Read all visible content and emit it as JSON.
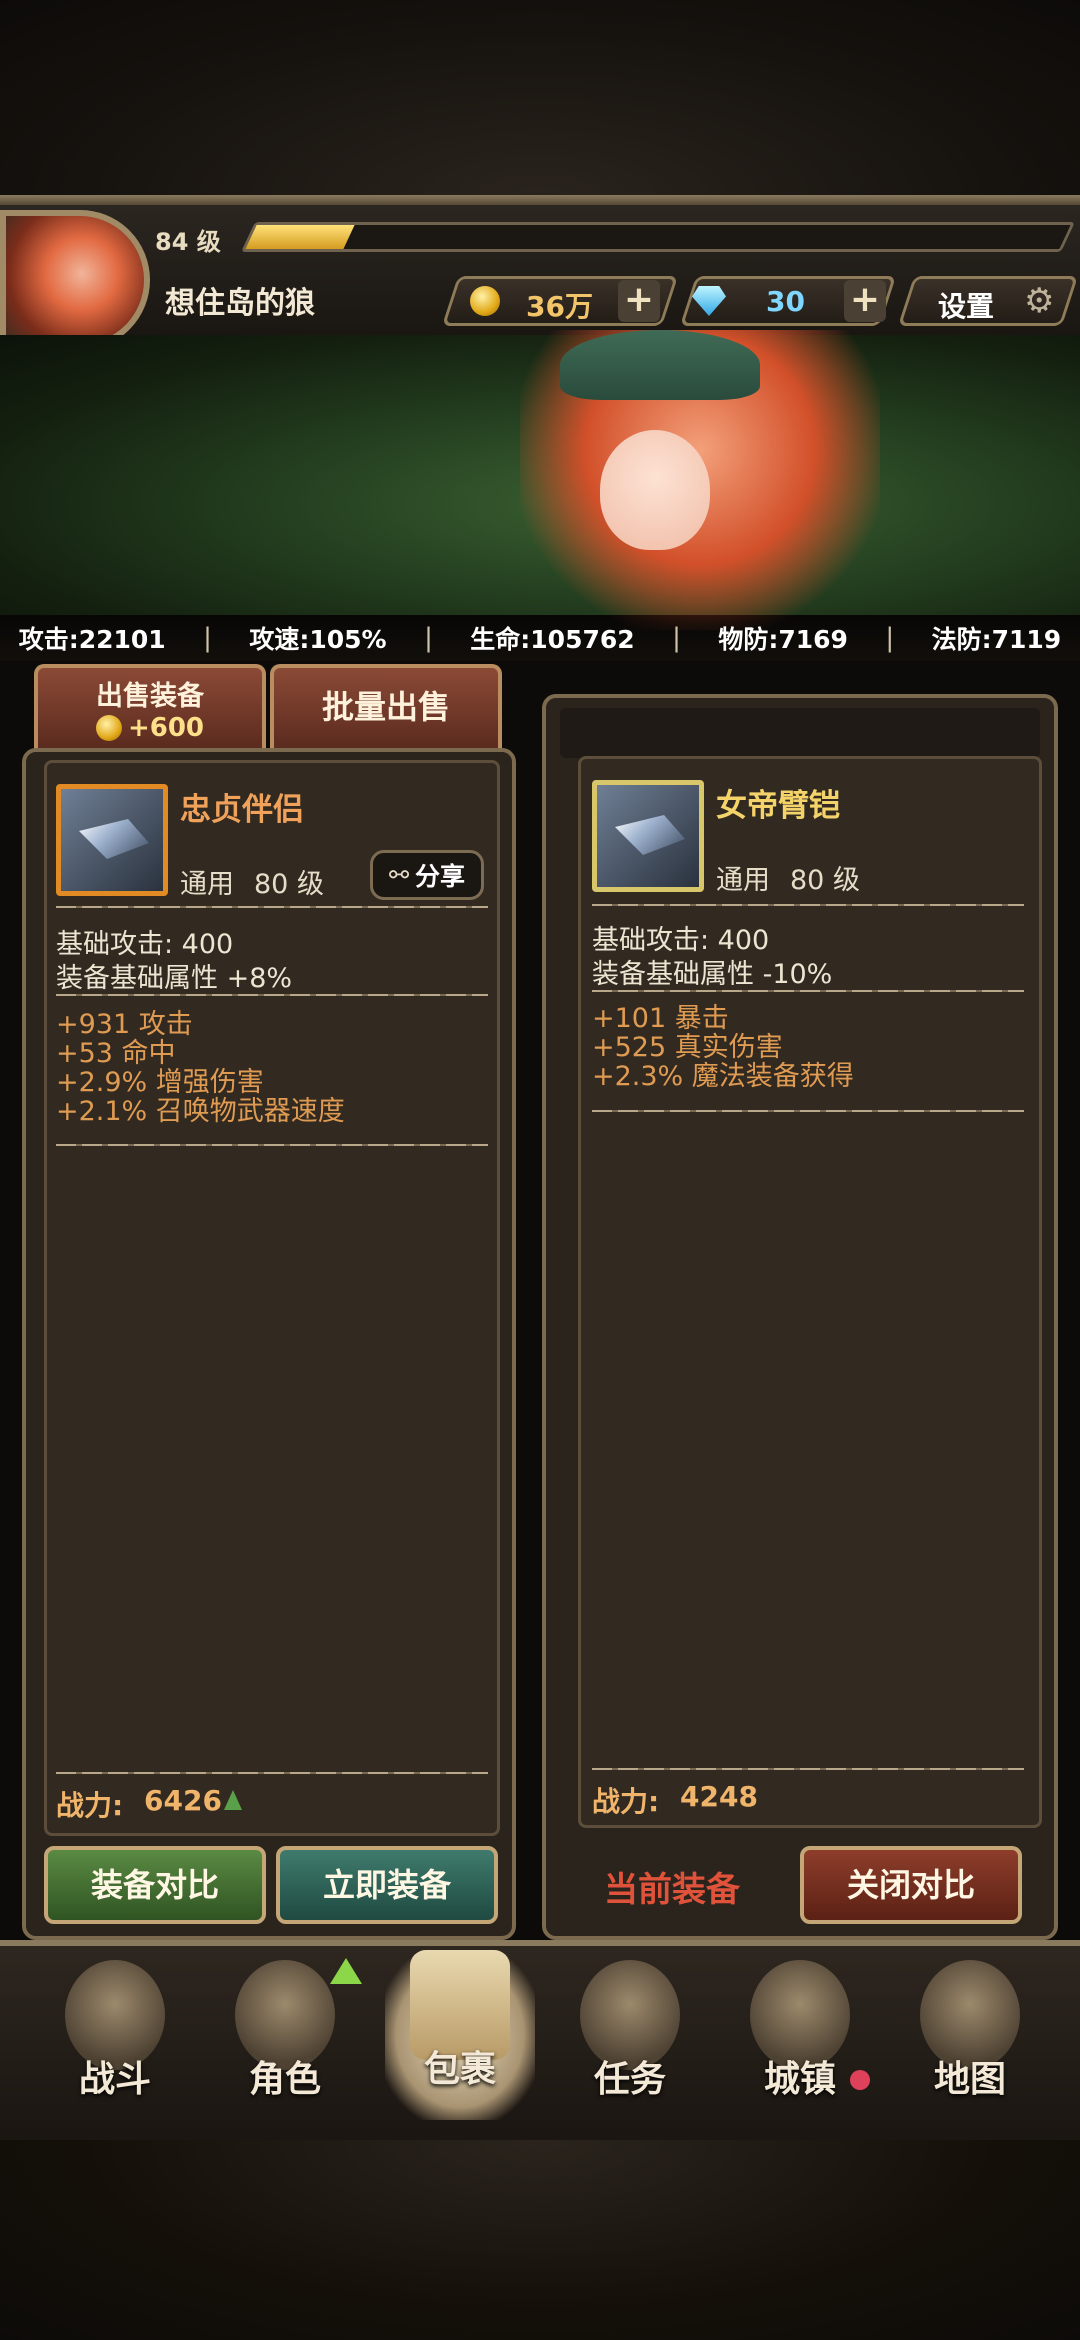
{
  "player": {
    "level": "84 级",
    "xp_fraction": 0.12,
    "name": "想住岛的狼",
    "gold": "36万",
    "gems": "30",
    "settings_label": "设置"
  },
  "stats": [
    {
      "label": "攻击:22101"
    },
    {
      "label": "攻速:105%"
    },
    {
      "label": "生命:105762"
    },
    {
      "label": "物防:7169"
    },
    {
      "label": "法防:7119"
    }
  ],
  "tabs": {
    "sell_label": "出售装备",
    "sell_value": "+600",
    "batch_sell_label": "批量出售"
  },
  "left_item": {
    "name": "忠贞伴侣",
    "type": "通用",
    "level": "80 级",
    "share_label": "分享",
    "base_attack": "基础攻击:  400",
    "base_attr": "装备基础属性 +8%",
    "bonuses": [
      "+931 攻击",
      "+53 命中",
      "+2.9% 增强伤害",
      "+2.1% 召唤物武器速度"
    ],
    "power_label": "战力:",
    "power_value": "6426",
    "compare_button": "装备对比",
    "equip_button": "立即装备"
  },
  "right_item": {
    "name": "女帝臂铠",
    "type": "通用",
    "level": "80 级",
    "base_attack": "基础攻击:  400",
    "base_attr": "装备基础属性 -10%",
    "bonuses": [
      "+101 暴击",
      "+525 真实伤害",
      "+2.3% 魔法装备获得"
    ],
    "power_label": "战力:",
    "power_value": "4248",
    "current_label": "当前装备",
    "close_button": "关闭对比"
  },
  "nav": [
    {
      "label": "战斗",
      "icon": "crossed-swords-icon"
    },
    {
      "label": "角色",
      "icon": "helmet-icon"
    },
    {
      "label": "包裹",
      "icon": "backpack-icon"
    },
    {
      "label": "任务",
      "icon": "scroll-icon"
    },
    {
      "label": "城镇",
      "icon": "tower-icon"
    },
    {
      "label": "地图",
      "icon": "map-icon"
    }
  ],
  "colors": {
    "accent_gold": "#f0b46a",
    "bonus_orange": "#e09b52",
    "left_item_name": "#f0a25a",
    "right_item_name": "#f3d36a",
    "current_equip_red": "#e0523a"
  }
}
